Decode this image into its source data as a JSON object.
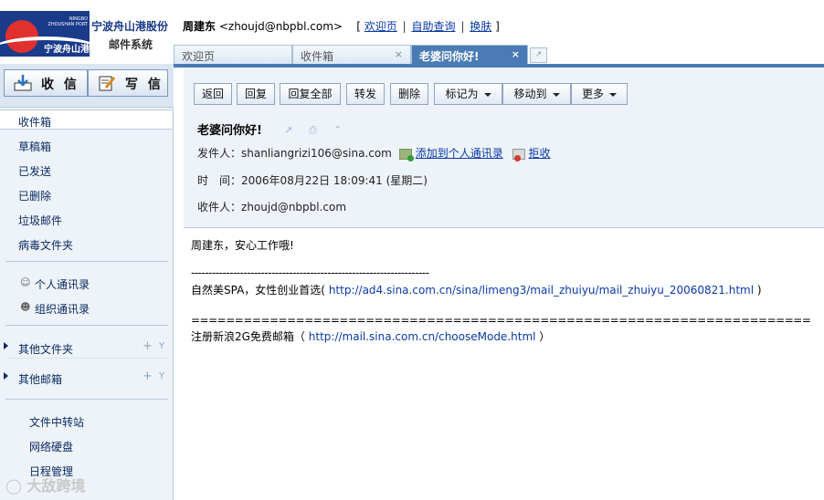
{
  "header": {
    "logo_en": "NINGBO ZHOUSHAN PORT",
    "logo_cn": "宁波舟山港",
    "org_name": "宁波舟山港股份",
    "system_name": "邮件系统",
    "user_name": "周建东",
    "user_email": "<zhoujd@nbpbl.com>",
    "bracket_open": "[",
    "bracket_close": "]",
    "sep": "|",
    "links": [
      "欢迎页",
      "自助查询",
      "换肤"
    ]
  },
  "tabs": [
    {
      "label": "欢迎页"
    },
    {
      "label": "收件箱",
      "close": "×"
    },
    {
      "label": "老婆问你好!",
      "close": "×"
    }
  ],
  "sidebar": {
    "receive_label": "收 信",
    "compose_label": "写 信",
    "folders": [
      "收件箱",
      "草稿箱",
      "已发送",
      "已删除",
      "垃圾邮件",
      "病毒文件夹"
    ],
    "contacts": [
      "个人通讯录",
      "组织通讯录"
    ],
    "other_folders": "其他文件夹",
    "other_mailboxes": "其他邮箱",
    "plus": "+",
    "y": "Y",
    "tools": [
      "文件中转站",
      "网络硬盘",
      "日程管理"
    ]
  },
  "toolbar": {
    "buttons": [
      "返回",
      "回复",
      "回复全部",
      "转发",
      "删除"
    ],
    "dropdowns": [
      "标记为",
      "移动到",
      "更多"
    ]
  },
  "mail": {
    "subject": "老婆问你好!",
    "from_label": "发件人：",
    "from_value": "shanliangrizi106@sina.com",
    "add_contact": "添加到个人通讯录",
    "reject": "拒收",
    "time_label": "时　间：",
    "time_value": "2006年08月22日 18:09:41 (星期二)",
    "to_label": "收件人：",
    "to_value": "zhoujd@nbpbl.com"
  },
  "body": {
    "greeting": "周建东，安心工作哦!",
    "dash_rule": "--------------------------------------------------------------------",
    "ad1_text": "自然美SPA，女性创业首选(",
    "ad1_link": "http://ad4.sina.com.cn/sina/limeng3/mail_zhuiyu/mail_zhuiyu_20060821.html",
    "ad1_close": ")",
    "eq_rule": "=======================================================================",
    "ad2_text": "注册新浪2G免费邮箱（",
    "ad2_link": "http://mail.sina.com.cn/chooseMode.html",
    "ad2_close": "）"
  },
  "watermark": "大敌跨境"
}
